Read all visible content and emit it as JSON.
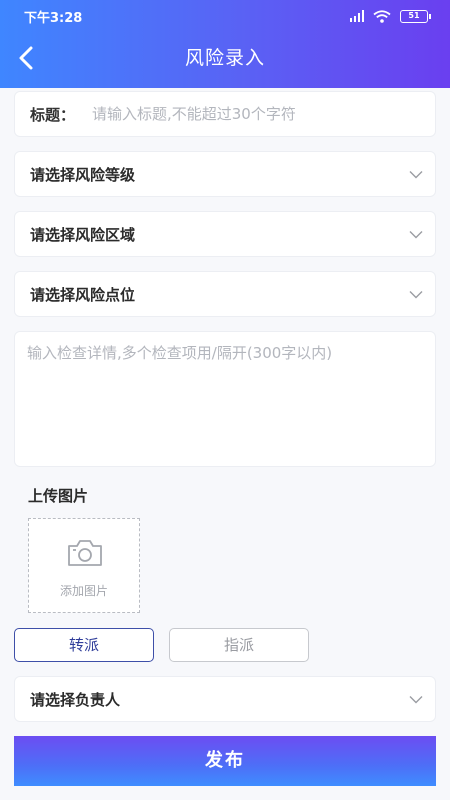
{
  "status_bar": {
    "time": "下午3:28",
    "battery": "51"
  },
  "header": {
    "title": "风险录入"
  },
  "form": {
    "title_label": "标题：",
    "title_placeholder": "请输入标题,不能超过30个字符",
    "level_select": "请选择风险等级",
    "area_select": "请选择风险区域",
    "point_select": "请选择风险点位",
    "detail_placeholder": "输入检查详情,多个检查项用/隔开(300字以内)",
    "upload_label": "上传图片",
    "upload_button": "添加图片",
    "transfer_label": "转派",
    "assign_label": "指派",
    "owner_select": "请选择负责人",
    "publish_label": "发布"
  },
  "colors": {
    "header_start": "#3f86ff",
    "header_end": "#6a3ff0",
    "accent": "#2f3d9a"
  }
}
